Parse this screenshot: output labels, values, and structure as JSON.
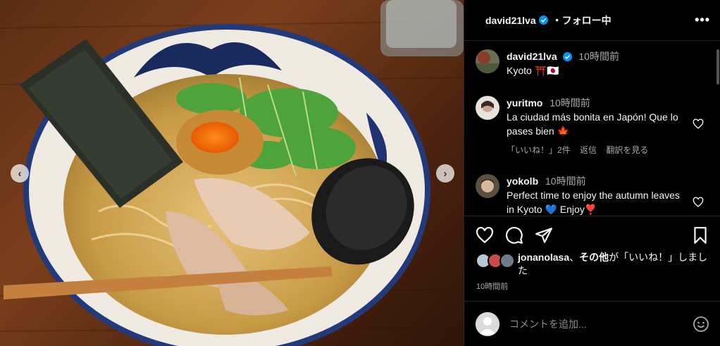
{
  "post": {
    "author": "david21lva",
    "follow_status": "・フォロー中",
    "more_label": "•••",
    "caption": {
      "username": "david21lva",
      "time": "10時間前",
      "text": "Kyoto ⛩️🇯🇵"
    }
  },
  "comments": [
    {
      "username": "yuritmo",
      "time": "10時間前",
      "text": "La ciudad más bonita en Japón! Que lo pases bien 🍁",
      "likes": "「いいね！」2件",
      "reply": "返信",
      "translate": "翻訳を見る"
    },
    {
      "username": "yokolb",
      "time": "10時間前",
      "text": "Perfect time to enjoy the autumn leaves in Kyoto 💙  Enjoy❣️"
    }
  ],
  "likes": {
    "user": "jonanolasa",
    "sep": "、",
    "others": "その他",
    "suffix": "が「いいね！」しました"
  },
  "post_time": "10時間前",
  "add_comment": {
    "placeholder": "コメントを追加..."
  },
  "nav": {
    "prev": "‹",
    "next": "›"
  },
  "colors": {
    "verified": "#0095f6",
    "heart": "#ffffff",
    "secondary_text": "#a8a8a8"
  }
}
